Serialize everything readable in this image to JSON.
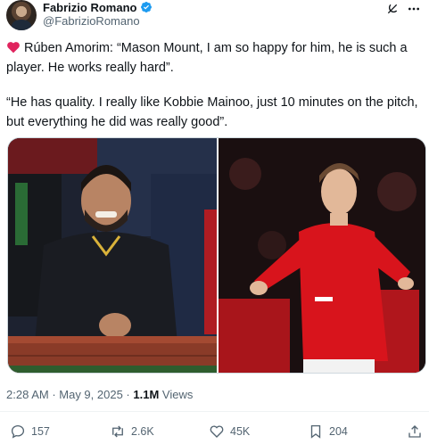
{
  "author": {
    "name": "Fabrizio Romano",
    "handle": "@FabrizioRomano"
  },
  "icons": {
    "verified": "verified-badge-icon",
    "grok": "grok-icon",
    "more": "more-options-icon",
    "heart_emoji": "red-heart-emoji"
  },
  "tweet": {
    "paragraph1": "Rúben Amorim: “Mason Mount, I am so happy for him, he is such a player. He works really hard”.",
    "paragraph2": "“He has quality. I really like Kobbie Mainoo, just 10 minutes on the pitch, but everything he did was really good”."
  },
  "meta": {
    "time": "2:28 AM",
    "separator1": " · ",
    "date": "May 9, 2025",
    "separator2": " · ",
    "views_count": "1.1M",
    "views_label": " Views"
  },
  "actions": {
    "replies": "157",
    "reposts": "2.6K",
    "likes": "45K",
    "bookmarks": "204"
  },
  "colors": {
    "text": "#0f1419",
    "secondary": "#536471",
    "verified": "#1d9bf0",
    "heart": "#e0245e",
    "united_red": "#d8141c"
  }
}
